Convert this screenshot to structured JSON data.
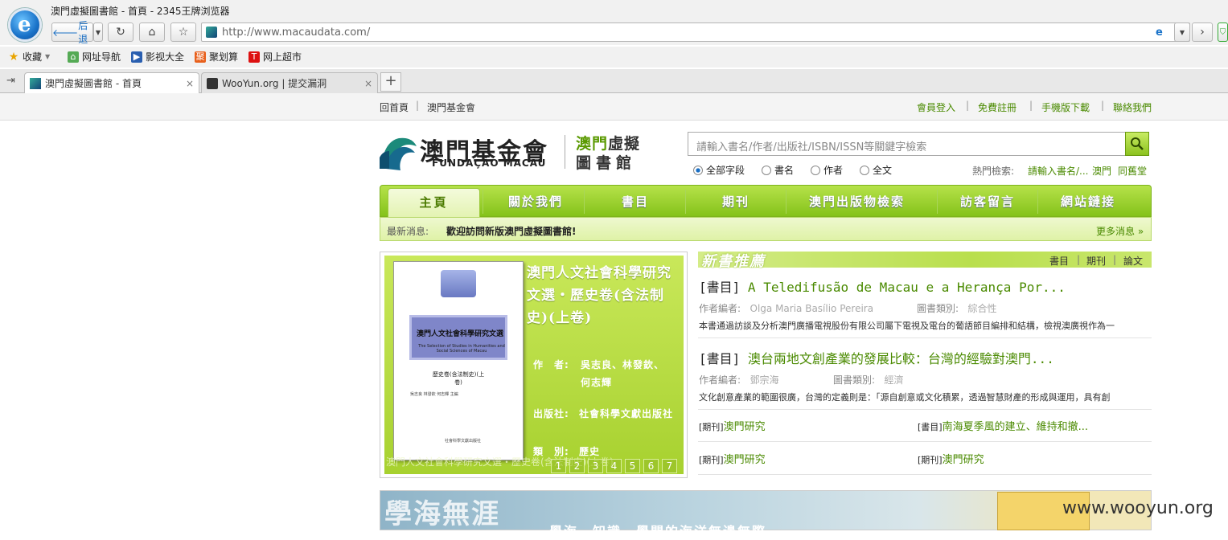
{
  "browser": {
    "window_title": "澳門虛擬圖書館 - 首頁 - 2345王牌浏览器",
    "back_label": "后退",
    "url": "http://www.macaudata.com/",
    "bookmarks": [
      "收藏",
      "网址导航",
      "影视大全",
      "聚划算",
      "网上超市"
    ],
    "tabs": [
      {
        "label": "澳門虛擬圖書館 - 首頁"
      },
      {
        "label": "WooYun.org | 提交漏洞"
      }
    ],
    "new_tab": "+"
  },
  "top_links": {
    "left": [
      "回首頁",
      "澳門基金會"
    ],
    "right": [
      "會員登入",
      "免費註冊",
      "手機版下載",
      "聯絡我們"
    ]
  },
  "logo": {
    "main": "澳門基金會",
    "sub": "FUNDAÇÃO MACAU",
    "lib_line1_a": "澳門",
    "lib_line1_b": "虛擬",
    "lib_line2": "圖書館"
  },
  "search": {
    "placeholder": "請輸入書名/作者/出版社/ISBN/ISSN等關鍵字檢索",
    "options": [
      "全部字段",
      "書名",
      "作者",
      "全文"
    ],
    "selected": "全部字段",
    "hot_label": "熱門檢索:",
    "hot_terms": [
      "請輸入書名/...",
      "澳門",
      "同舊堂"
    ]
  },
  "menu": [
    "主頁",
    "關於我們",
    "書目",
    "期刊",
    "澳門出版物檢索",
    "訪客留言",
    "網站鏈接"
  ],
  "news": {
    "label": "最新消息:",
    "text": "歡迎訪問新版澳門虛擬圖書館!",
    "more": "更多消息 »"
  },
  "feature": {
    "cover_title": "澳門人文社會科學研究文選",
    "cover_sub": "The Selection of Studies in Humanities and Social Sciences of Macau",
    "cover_vol": "歷史卷(含法制史)(上卷)",
    "cover_authors": "吳志良 林發欽 何志輝 主編",
    "cover_pub": "社會科學文獻出版社",
    "title": "澳門人文社會科學研究文選・歷史卷(含法制史)(上卷)",
    "author_label": "作　者:",
    "authors": "吳志良、林發欽、",
    "authors2": "何志輝",
    "publisher_label": "出版社:",
    "publisher": "社會科學文獻出版社",
    "category_label": "類　別:",
    "category": "歷史",
    "caption": "澳門人文社會科學研究文選・歷史卷(含法制史)(上卷)",
    "pages": [
      "1",
      "2",
      "3",
      "4",
      "5",
      "6",
      "7"
    ]
  },
  "new_books": {
    "title": "新書推薦",
    "tabs": [
      "書目",
      "期刊",
      "論文"
    ],
    "records": [
      {
        "tag": "[書目]",
        "title": "A Teledifusão de Macau e a Herança Por...",
        "author_label": "作者編者:",
        "author": "Olga Maria Basílio Pereira",
        "cat_label": "圖書類別:",
        "category": "綜合性",
        "desc": "本書通過訪談及分析澳門廣播電視股份有限公司屬下電視及電台的葡語節目編排和結構，檢視澳廣視作為一"
      },
      {
        "tag": "[書目]",
        "title": "澳台兩地文創產業的發展比較：台灣的經驗對澳門...",
        "author_label": "作者編者:",
        "author": "鄧宗海",
        "cat_label": "圖書類別:",
        "category": "經濟",
        "desc": "文化創意產業的範圍很廣，台灣的定義則是：「源自創意或文化積累，透過智慧財產的形成與運用，具有創"
      }
    ],
    "small": [
      {
        "tag": "[期刊]",
        "title": "澳門研究"
      },
      {
        "tag": "[書目]",
        "title": "南海夏季風的建立、維持和撤..."
      },
      {
        "tag": "[期刊]",
        "title": "澳門研究"
      },
      {
        "tag": "[期刊]",
        "title": "澳門研究"
      }
    ]
  },
  "banner": {
    "title": "學海無涯",
    "subtitle": "學海、知識、學問的海洋無邊無際"
  },
  "watermark": "www.wooyun.org"
}
